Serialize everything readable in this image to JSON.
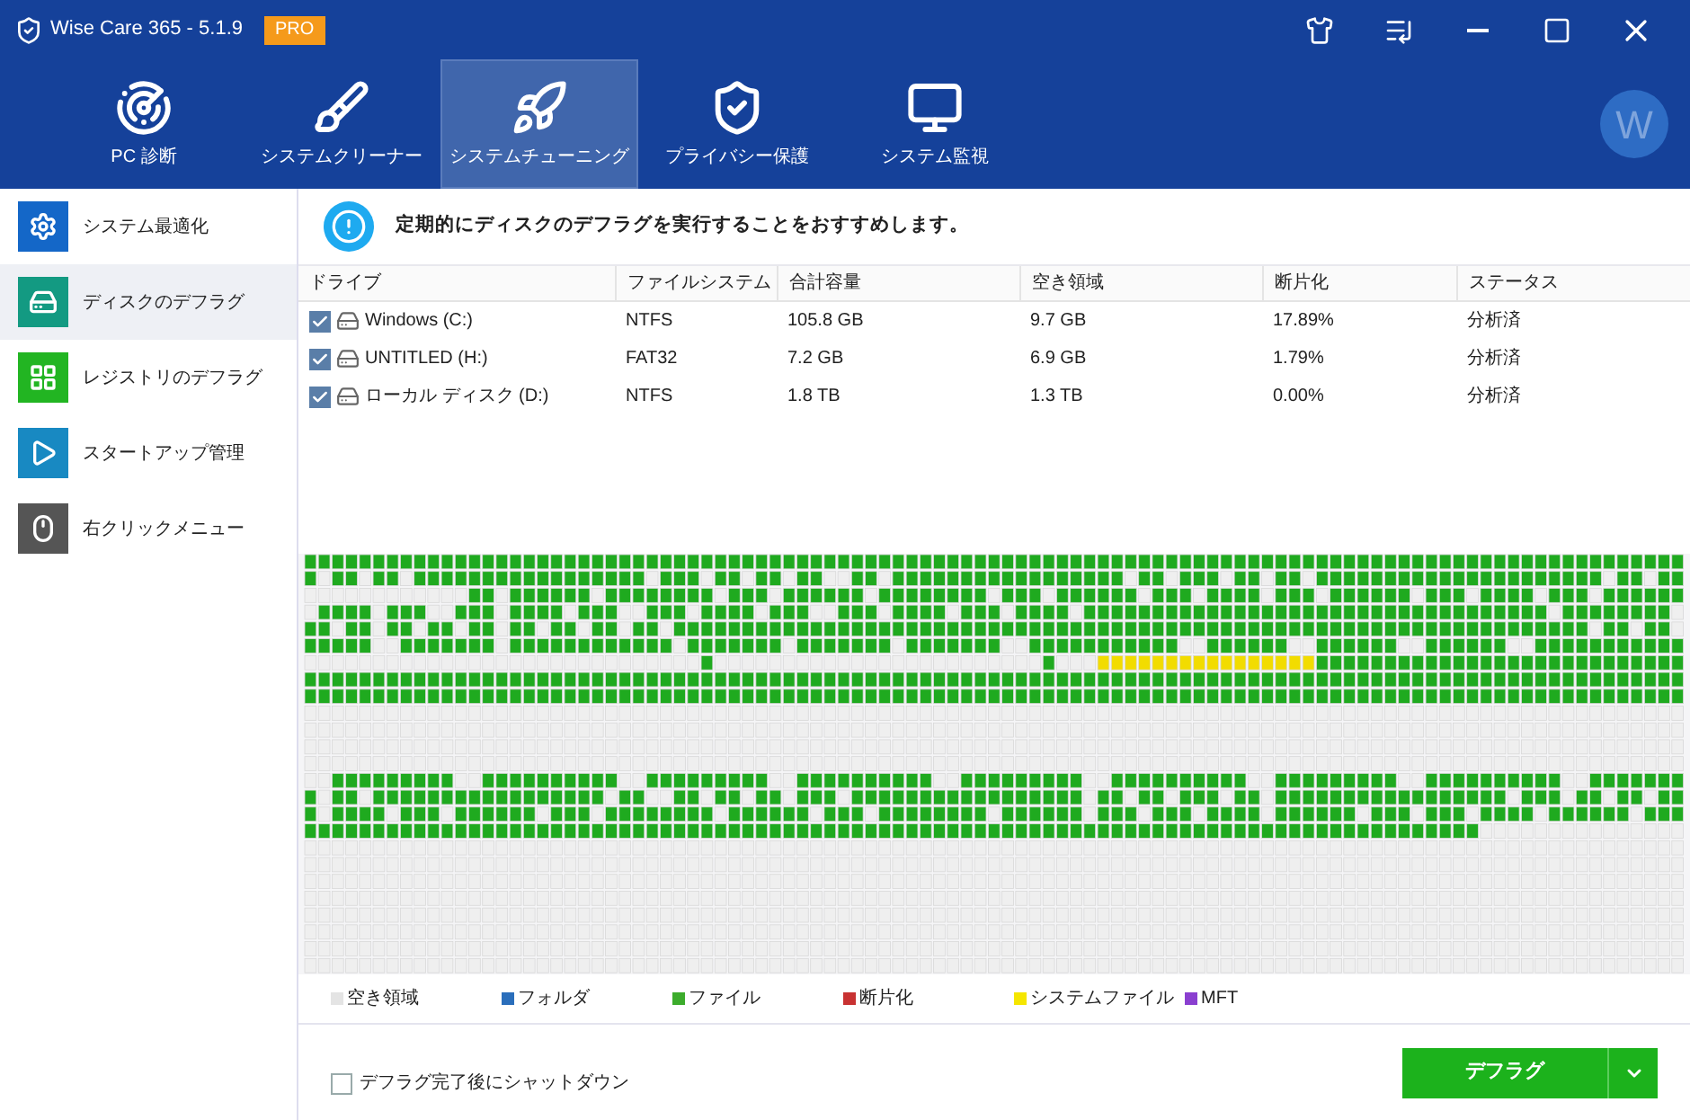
{
  "window": {
    "title": "Wise Care 365 - 5.1.9",
    "badge": "PRO"
  },
  "nav_tabs": [
    {
      "label": "PC 診断",
      "selected": false
    },
    {
      "label": "システムクリーナー",
      "selected": false
    },
    {
      "label": "システムチューニング",
      "selected": true
    },
    {
      "label": "プライバシー保護",
      "selected": false
    },
    {
      "label": "システム監視",
      "selected": false
    }
  ],
  "avatar": {
    "letter": "W"
  },
  "sidebar": {
    "items": [
      {
        "label": "システム最適化",
        "selected": false,
        "color": "#1467c8"
      },
      {
        "label": "ディスクのデフラグ",
        "selected": true,
        "color": "#139a82"
      },
      {
        "label": "レジストリのデフラグ",
        "selected": false,
        "color": "#22b522"
      },
      {
        "label": "スタートアップ管理",
        "selected": false,
        "color": "#1889c2"
      },
      {
        "label": "右クリックメニュー",
        "selected": false,
        "color": "#555555"
      }
    ]
  },
  "notice": "定期的にディスクのデフラグを実行することをおすすめします。",
  "table": {
    "columns": [
      "ドライブ",
      "ファイルシステム",
      "合計容量",
      "空き領域",
      "断片化",
      "ステータス"
    ],
    "rows": [
      {
        "checked": true,
        "cells": [
          "Windows (C:)",
          "NTFS",
          "105.8 GB",
          "9.7 GB",
          "17.89%",
          "分析済"
        ]
      },
      {
        "checked": true,
        "cells": [
          "UNTITLED (H:)",
          "FAT32",
          "7.2 GB",
          "6.9 GB",
          "1.79%",
          "分析済"
        ]
      },
      {
        "checked": true,
        "cells": [
          "ローカル ディスク (D:)",
          "NTFS",
          "1.8 TB",
          "1.3 TB",
          "0.00%",
          "分析済"
        ]
      }
    ]
  },
  "legend": [
    {
      "label": "空き領域",
      "color": "#e4e4e4"
    },
    {
      "label": "フォルダ",
      "color": "#2a6ebb"
    },
    {
      "label": "ファイル",
      "color": "#3cac2c"
    },
    {
      "label": "断片化",
      "color": "#c83232"
    },
    {
      "label": "システムファイル",
      "color": "#f5e600"
    },
    {
      "label": "MFT",
      "color": "#8a3fd0"
    }
  ],
  "shutdown_option": {
    "label": "デフラグ完了後にシャットダウン",
    "checked": false
  },
  "defrag_button": {
    "label": "デフラグ"
  }
}
